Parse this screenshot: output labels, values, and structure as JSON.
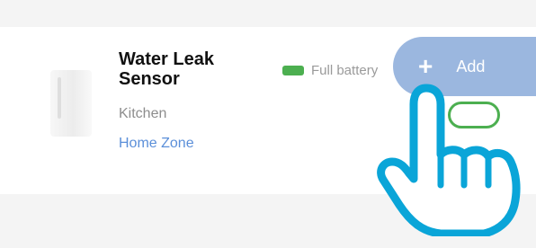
{
  "device": {
    "name": "Water Leak Sensor",
    "room": "Kitchen",
    "zone": "Home Zone",
    "battery_status": "Full battery",
    "battery_color": "#4caf50",
    "enabled": true
  },
  "add_button": {
    "icon": "plus-icon",
    "label": "Add",
    "color": "#9bb7df"
  },
  "overlay": {
    "icon": "pointing-hand-icon",
    "outline_color": "#0aa5d8"
  },
  "colors": {
    "zone_link": "#5b8fd9",
    "toggle_on": "#4caf50"
  }
}
